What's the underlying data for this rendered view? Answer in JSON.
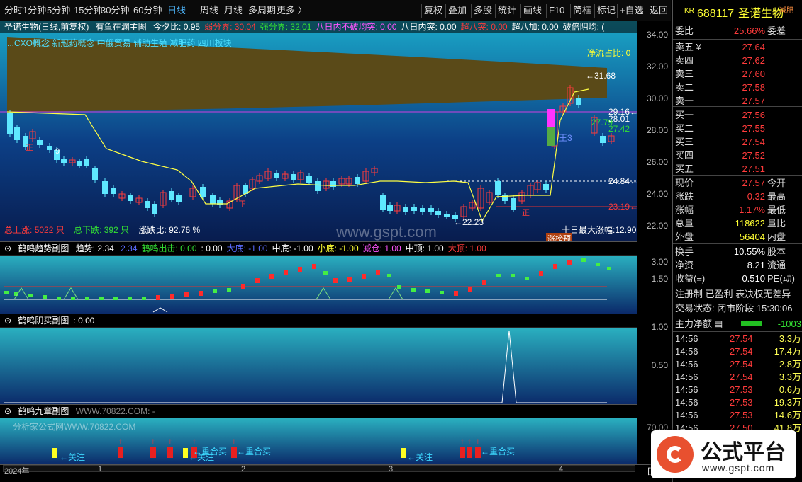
{
  "toolbar": {
    "left": [
      "分时",
      "1分钟",
      "5分钟",
      "15分钟",
      "30分钟",
      "60分钟",
      "日线",
      "周线",
      "月线",
      "多周期",
      "更多 〉"
    ],
    "right": [
      "复权",
      "叠加",
      "多股",
      "统计",
      "画线",
      "F10",
      "简框",
      "标记",
      "+自选",
      "返回"
    ]
  },
  "main": {
    "stock_name": "圣诺生物(日线,前复权)",
    "formula": "有鱼在渊主图",
    "indicators": [
      {
        "label": "今夕比:",
        "value": "0.95",
        "color": "#ffffff"
      },
      {
        "label": "弱分界:",
        "value": "30.04",
        "color": "#ff3b3b"
      },
      {
        "label": "强分界:",
        "value": "32.01",
        "color": "#33e033"
      },
      {
        "label": "八日内不破均突:",
        "value": "0.00",
        "color": "#ff55ff"
      },
      {
        "label": "八日内突:",
        "value": "0.00",
        "color": "#ffffff"
      },
      {
        "label": "超八突:",
        "value": "0.00",
        "color": "#ff3b3b"
      },
      {
        "label": "超八加:",
        "value": "0.00",
        "color": "#ffffff"
      },
      {
        "label": "破倍阴均:",
        "value": "(",
        "color": "#ffffff"
      }
    ],
    "concepts": "...CXO概念  新冠药概念  中俄贸易  辅助生殖  减肥药  四川板块",
    "jingliu": "净流占比: 0",
    "stats": {
      "up_label": "总上涨:",
      "up_value": "5022 只",
      "down_label": "总下跌:",
      "down_value": "392 只",
      "ratio_label": "涨跌比:",
      "ratio_value": "92.76 %"
    },
    "ten_day": "十日最大涨幅:12.90",
    "board_tag": "涨榜预",
    "watermark": "www.gspt.com",
    "yticks": [
      "34.00",
      "32.00",
      "30.00",
      "28.00",
      "26.00",
      "24.00",
      "22.00"
    ],
    "prices": {
      "high": "31.68",
      "p1": "29.16",
      "p2": "28.01",
      "p3": "27.79",
      "p4": "27.42",
      "p5": "24.84",
      "p6": "23.19",
      "low": "22.23"
    },
    "marks": {
      "wang": "王3",
      "zheng": "正",
      "nine": "9"
    }
  },
  "sub1": {
    "title": "鹤鸣趋势副图",
    "items": [
      {
        "label": "趋势:",
        "value": "2.34",
        "color": "#ffffff"
      },
      {
        "label": "",
        "value": "2.34",
        "color": "#5a6cff"
      },
      {
        "label": "鹤鸣出击:",
        "value": "0.00",
        "color": "#33e033"
      },
      {
        "label": ":",
        "value": "0.00",
        "color": "#ffffff"
      },
      {
        "label": "大底:",
        "value": "-1.00",
        "color": "#5a6cff"
      },
      {
        "label": "中底:",
        "value": "-1.00",
        "color": "#ffffff"
      },
      {
        "label": "小底:",
        "value": "-1.00",
        "color": "#ffff33"
      },
      {
        "label": "减仓:",
        "value": "1.00",
        "color": "#ff55ff"
      },
      {
        "label": "中顶:",
        "value": "1.00",
        "color": "#ffffff"
      },
      {
        "label": "大顶:",
        "value": "1.00",
        "color": "#ff3b3b"
      }
    ],
    "yticks": [
      "3.00",
      "1.50"
    ]
  },
  "sub2": {
    "title": "鹤鸣阴买副图",
    "value": ": 0.00",
    "yticks": [
      "1.00",
      "0.50"
    ]
  },
  "sub3": {
    "title": "鹤鸣九章副图",
    "extra": "WWW.70822.COM: -",
    "watermark": "分析家公式网WWW.70822.COM",
    "yticks": [
      "70.00",
      "3"
    ],
    "labels": {
      "guanzhu": "←关注",
      "chonghe": "←重合买"
    }
  },
  "xaxis": {
    "labels": [
      "2024年",
      "1",
      "2",
      "3",
      "4"
    ],
    "right_label": "日"
  },
  "right": {
    "code": "688117",
    "name": "圣诺生物",
    "prefix": "KR",
    "extra": "减肥",
    "weibi_label": "委比",
    "weibi_value": "25.66%",
    "weicha_label": "委差",
    "asks": [
      {
        "l": "卖五 ¥",
        "p": "27.64"
      },
      {
        "l": "卖四",
        "p": "27.62"
      },
      {
        "l": "卖三",
        "p": "27.60"
      },
      {
        "l": "卖二",
        "p": "27.58"
      },
      {
        "l": "卖一",
        "p": "27.57"
      }
    ],
    "bids": [
      {
        "l": "买一",
        "p": "27.56"
      },
      {
        "l": "买二",
        "p": "27.55"
      },
      {
        "l": "买三",
        "p": "27.54"
      },
      {
        "l": "买四",
        "p": "27.52"
      },
      {
        "l": "买五",
        "p": "27.51"
      }
    ],
    "quote": [
      {
        "l": "现价",
        "v": "27.57",
        "r": "今开"
      },
      {
        "l": "涨跌",
        "v": "0.32",
        "r": "最高"
      },
      {
        "l": "涨幅",
        "v": "1.17%",
        "r": "最低"
      },
      {
        "l": "总量",
        "v": "118622",
        "r": "量比"
      },
      {
        "l": "外盘",
        "v": "56404",
        "r": "内盘"
      }
    ],
    "info": [
      {
        "l": "换手",
        "v": "10.55%",
        "r": "股本"
      },
      {
        "l": "净资",
        "v": "8.21",
        "r": "流通"
      },
      {
        "l": "收益(≡)",
        "v": "0.510",
        "r": "PE(动)"
      }
    ],
    "register": "注册制 已盈利 表决权无差异",
    "status": "交易状态: 闭市阶段 15:30:06",
    "net_label": "主力净额",
    "net_value": "-1003",
    "trades": [
      {
        "t": "14:56",
        "p": "27.54",
        "v": "3.3万"
      },
      {
        "t": "14:56",
        "p": "27.54",
        "v": "17.4万"
      },
      {
        "t": "14:56",
        "p": "27.54",
        "v": "2.8万"
      },
      {
        "t": "14:56",
        "p": "27.54",
        "v": "3.3万"
      },
      {
        "t": "14:56",
        "p": "27.53",
        "v": "0.6万"
      },
      {
        "t": "14:56",
        "p": "27.53",
        "v": "19.3万"
      },
      {
        "t": "14:56",
        "p": "27.53",
        "v": "14.6万"
      },
      {
        "t": "14:56",
        "p": "27.50",
        "v": "41.8万"
      }
    ]
  },
  "logo": {
    "text": "公式平台",
    "url": "www.gspt.com"
  },
  "colors": {
    "up": "#ff3b3b",
    "down": "#5ee8ff",
    "ma": "#ffff44",
    "bg_top": "#0e2a6a",
    "bg_bottom": "#073a5a"
  }
}
